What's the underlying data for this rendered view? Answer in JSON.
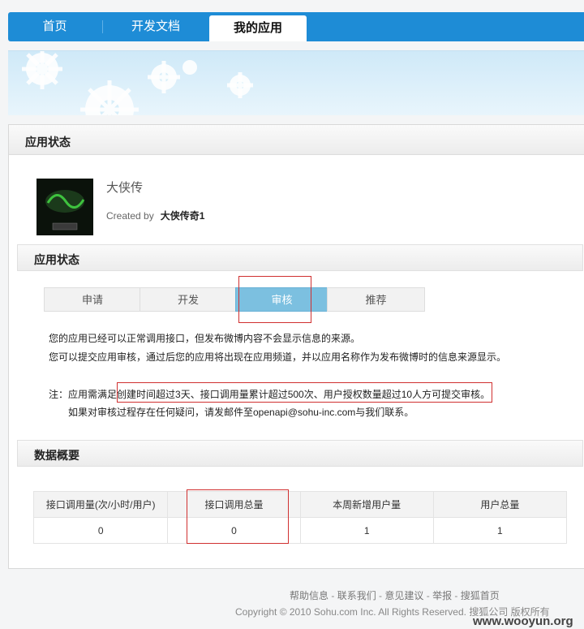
{
  "nav": {
    "tabs": [
      {
        "label": "首页"
      },
      {
        "label": "开发文档"
      },
      {
        "label": "我的应用"
      }
    ]
  },
  "panel": {
    "title": "应用状态"
  },
  "app": {
    "name": "大侠传",
    "created_by_label": "Created by",
    "creator": "大侠传奇1"
  },
  "status": {
    "title": "应用状态",
    "steps": [
      {
        "label": "申请"
      },
      {
        "label": "开发"
      },
      {
        "label": "审核"
      },
      {
        "label": "推荐"
      }
    ],
    "active_step": "审核",
    "line1": "您的应用已经可以正常调用接口，但发布微博内容不会显示信息的来源。",
    "line2": "您可以提交应用审核，通过后您的应用将出现在应用频道，并以应用名称作为发布微博时的信息来源显示。",
    "note_label": "注：",
    "note_prefix": "应用需满足",
    "note_rest": "创建时间超过3天、接口调用量累计超过500次、用户授权数量超过10人方可提交审核。",
    "contact": "如果对审核过程存在任何疑问，请发邮件至openapi@sohu-inc.com与我们联系。"
  },
  "overview": {
    "title": "数据概要",
    "headers": [
      "接口调用量(次/小时/用户)",
      "接口调用总量",
      "本周新增用户量",
      "用户总量"
    ],
    "values": [
      "0",
      "0",
      "1",
      "1"
    ]
  },
  "footer": {
    "links": [
      "帮助信息",
      "联系我们",
      "意见建议",
      "举报",
      "搜狐首页"
    ],
    "separator": " - ",
    "copyright": "Copyright © 2010 Sohu.com Inc. All Rights Reserved. 搜狐公司 版权所有"
  },
  "watermark": "www.wooyun.org",
  "colors": {
    "nav_blue": "#1e8cd6",
    "active_step": "#7cc0e0",
    "highlight_red": "#d03030"
  }
}
